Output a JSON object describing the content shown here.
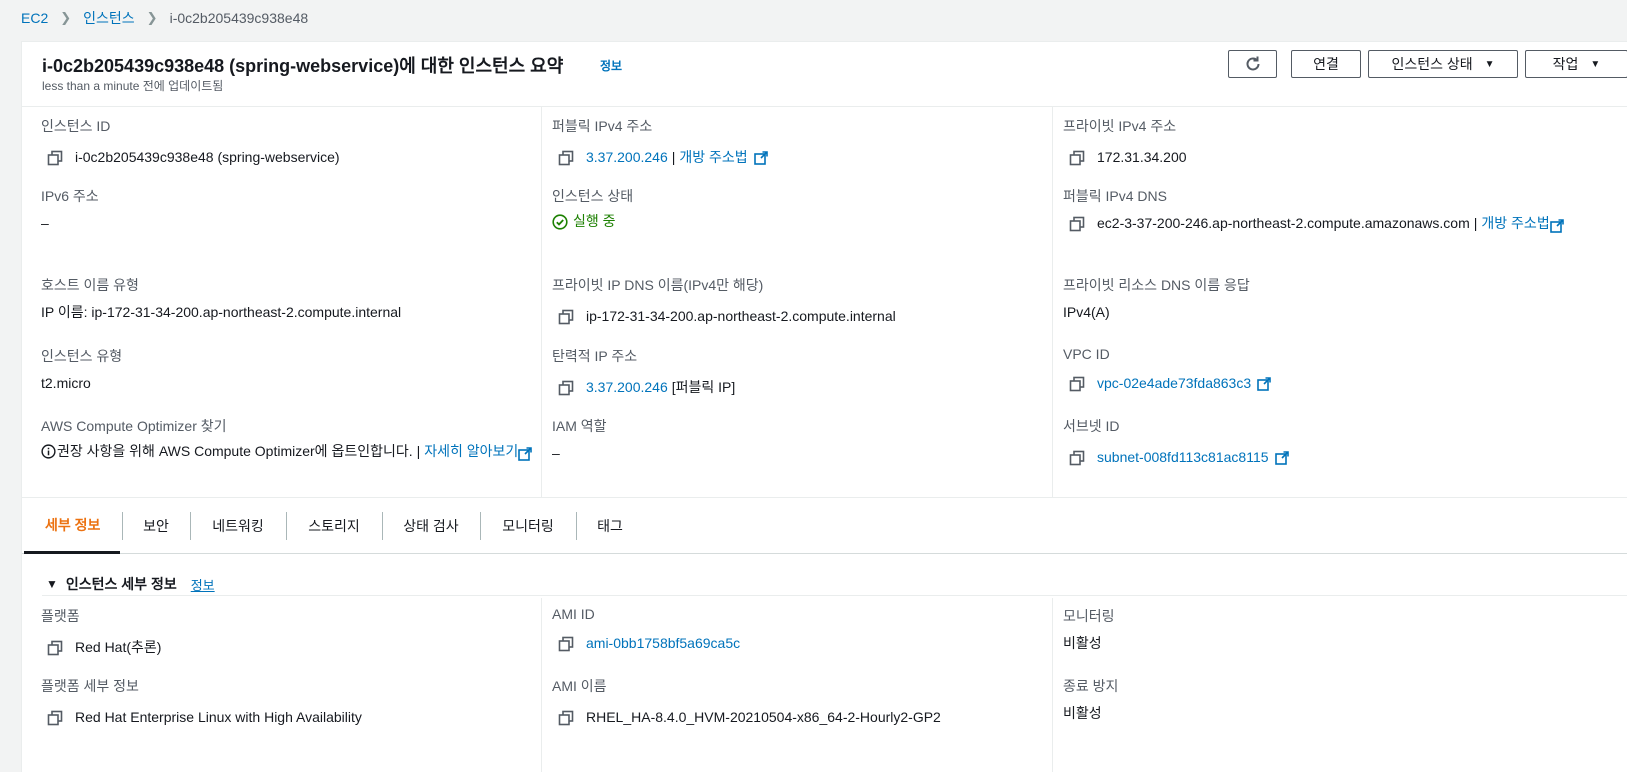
{
  "breadcrumb": {
    "root": "EC2",
    "section": "인스턴스",
    "current": "i-0c2b205439c938e48"
  },
  "header": {
    "title": "i-0c2b205439c938e48 (spring-webservice)에 대한 인스턴스 요약",
    "info_link": "정보",
    "subtitle": "less than a minute 전에 업데이트됨",
    "buttons": {
      "connect": "연결",
      "instance_state": "인스턴스 상태",
      "actions": "작업"
    }
  },
  "summary": {
    "instance_id": {
      "label": "인스턴스 ID",
      "value": "i-0c2b205439c938e48 (spring-webservice)"
    },
    "public_ipv4": {
      "label": "퍼블릭 IPv4 주소",
      "value": "3.37.200.246",
      "open_link": "개방 주소법"
    },
    "private_ipv4": {
      "label": "프라이빗 IPv4 주소",
      "value": "172.31.34.200"
    },
    "ipv6": {
      "label": "IPv6 주소",
      "value": "–"
    },
    "instance_state": {
      "label": "인스턴스 상태",
      "value": "실행 중"
    },
    "public_dns": {
      "label": "퍼블릭 IPv4 DNS",
      "value": "ec2-3-37-200-246.ap-northeast-2.compute.amazonaws.com",
      "open_link": "개방 주소법"
    },
    "hostname_type": {
      "label": "호스트 이름 유형",
      "value": "IP 이름: ip-172-31-34-200.ap-northeast-2.compute.internal"
    },
    "private_dns": {
      "label": "프라이빗 IP DNS 이름(IPv4만 해당)",
      "value": "ip-172-31-34-200.ap-northeast-2.compute.internal"
    },
    "private_resource_dns": {
      "label": "프라이빗 리소스 DNS 이름 응답",
      "value": "IPv4(A)"
    },
    "instance_type": {
      "label": "인스턴스 유형",
      "value": "t2.micro"
    },
    "elastic_ip": {
      "label": "탄력적 IP 주소",
      "value": "3.37.200.246",
      "suffix": "[퍼블릭 IP]"
    },
    "vpc_id": {
      "label": "VPC ID",
      "value": "vpc-02e4ade73fda863c3"
    },
    "optimizer": {
      "label": "AWS Compute Optimizer 찾기",
      "value": "권장 사항을 위해 AWS Compute Optimizer에 옵트인합니다.",
      "link": "자세히 알아보기"
    },
    "iam_role": {
      "label": "IAM 역할",
      "value": "–"
    },
    "subnet_id": {
      "label": "서브넷 ID",
      "value": "subnet-008fd113c81ac8115"
    }
  },
  "tabs": [
    "세부 정보",
    "보안",
    "네트워킹",
    "스토리지",
    "상태 검사",
    "모니터링",
    "태그"
  ],
  "details": {
    "heading": "인스턴스 세부 정보",
    "info_link": "정보",
    "platform": {
      "label": "플랫폼",
      "value": "Red Hat(추론)"
    },
    "ami_id": {
      "label": "AMI ID",
      "value": "ami-0bb1758bf5a69ca5c"
    },
    "monitoring": {
      "label": "모니터링",
      "value": "비활성"
    },
    "platform_details": {
      "label": "플랫폼 세부 정보",
      "value": "Red Hat Enterprise Linux with High Availability"
    },
    "ami_name": {
      "label": "AMI 이름",
      "value": "RHEL_HA-8.4.0_HVM-20210504-x86_64-2-Hourly2-GP2"
    },
    "termination_protection": {
      "label": "종료 방지",
      "value": "비활성"
    }
  },
  "colors": {
    "link": "#0073bb",
    "active_tab": "#ec7211",
    "success": "#1d8102"
  },
  "icons": [
    "refresh-icon",
    "copy-icon",
    "external-link-icon",
    "check-circle-icon",
    "info-circle-icon",
    "caret-down-icon",
    "triangle-down-icon"
  ]
}
